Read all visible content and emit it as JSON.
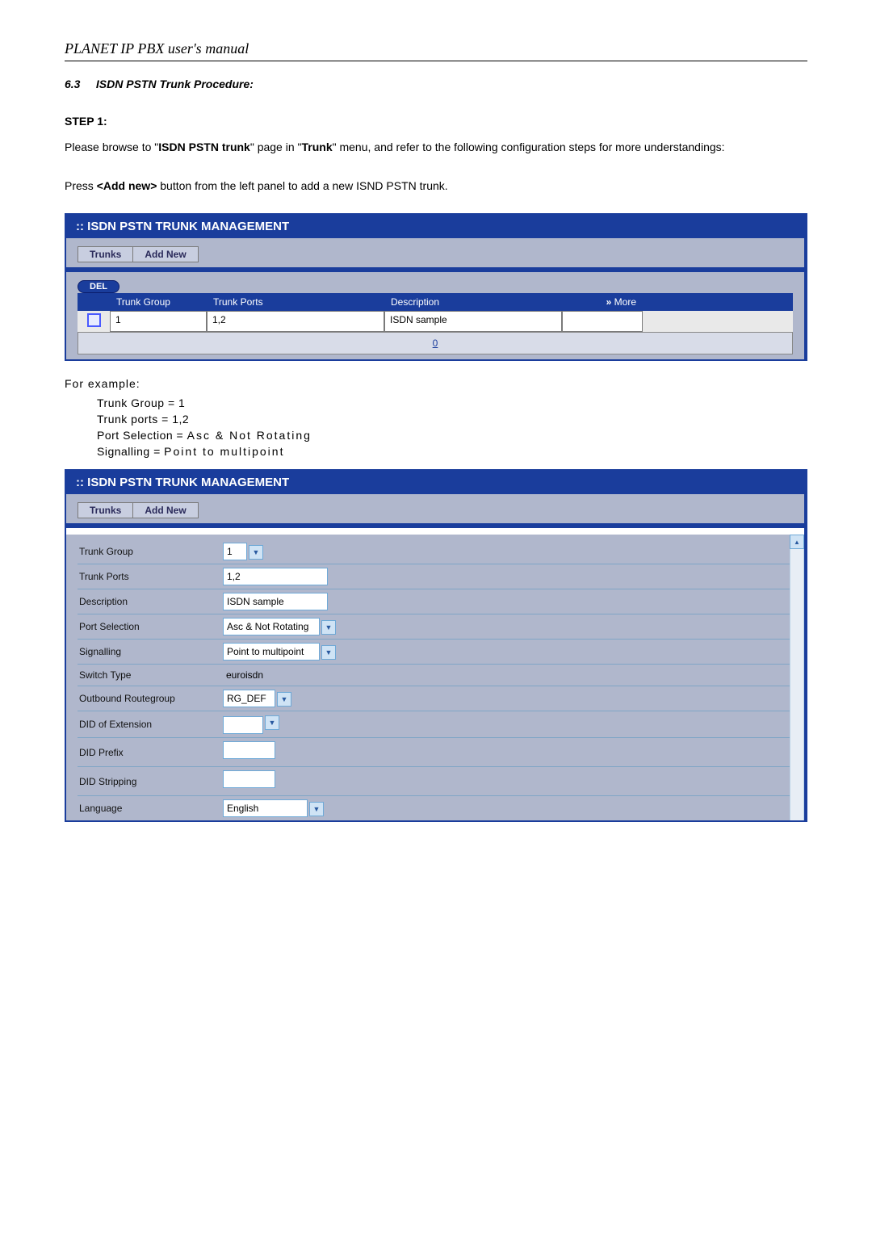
{
  "manual_title": "PLANET IP PBX user's manual",
  "section": {
    "number": "6.3",
    "title": "ISDN PSTN Trunk Procedure:"
  },
  "step1": {
    "label": "STEP 1:",
    "para1_prefix": "Please browse to \"",
    "para1_bold1": "ISDN PSTN trunk",
    "para1_mid1": "\" page in \"",
    "para1_bold2": "Trunk",
    "para1_mid2": "\" menu, and refer to the following configuration steps for more understandings:",
    "para2_prefix": "Press ",
    "para2_bold": "<Add new>",
    "para2_suffix": " button from the left panel to add a new ISND PSTN trunk."
  },
  "screenshot1": {
    "title": ":: ISDN PSTN TRUNK MANAGEMENT",
    "tabs": {
      "trunks": "Trunks",
      "addnew": "Add New"
    },
    "del": "DEL",
    "headers": {
      "tg": "Trunk Group",
      "tp": "Trunk Ports",
      "desc": "Description",
      "more": "More"
    },
    "row": {
      "tg": "1",
      "tp": "1,2",
      "desc": "ISDN sample"
    },
    "footer": "0"
  },
  "example": {
    "label": "For example:",
    "lines": {
      "l1": "Trunk Group = 1",
      "l2": "Trunk ports = 1,2",
      "l3_a": "Port Selection = ",
      "l3_b": "Asc & Not Rotating",
      "l4_a": "Signalling = ",
      "l4_b": "Point to multipoint"
    }
  },
  "screenshot2": {
    "title": ":: ISDN PSTN TRUNK MANAGEMENT",
    "tabs": {
      "trunks": "Trunks",
      "addnew": "Add New"
    },
    "fields": {
      "trunk_group": {
        "label": "Trunk Group",
        "value": "1"
      },
      "trunk_ports": {
        "label": "Trunk Ports",
        "value": "1,2"
      },
      "description": {
        "label": "Description",
        "value": "ISDN sample"
      },
      "port_selection": {
        "label": "Port Selection",
        "value": "Asc & Not Rotating"
      },
      "signalling": {
        "label": "Signalling",
        "value": "Point to multipoint"
      },
      "switch_type": {
        "label": "Switch Type",
        "value": "euroisdn"
      },
      "outbound_rg": {
        "label": "Outbound Routegroup",
        "value": "RG_DEF"
      },
      "did_ext": {
        "label": "DID of Extension",
        "value": ""
      },
      "did_prefix": {
        "label": "DID Prefix",
        "value": ""
      },
      "did_stripping": {
        "label": "DID Stripping",
        "value": ""
      },
      "language": {
        "label": "Language",
        "value": "English"
      }
    }
  }
}
